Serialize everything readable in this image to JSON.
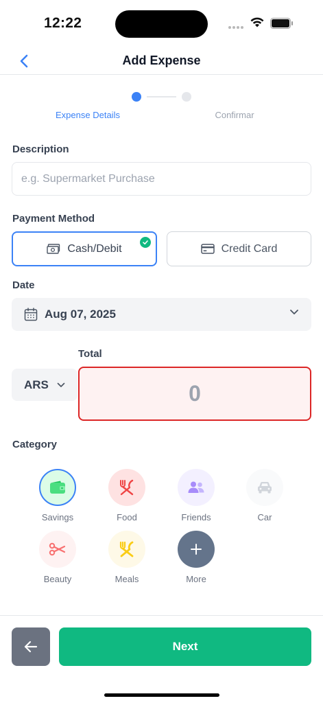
{
  "status_bar": {
    "time": "12:22"
  },
  "nav": {
    "title": "Add Expense"
  },
  "stepper": {
    "steps": [
      "Expense Details",
      "Confirmar"
    ],
    "active_step": 1
  },
  "description": {
    "label": "Description",
    "placeholder": "e.g. Supermarket Purchase",
    "value": ""
  },
  "payment": {
    "label": "Payment Method",
    "options": [
      {
        "label": "Cash/Debit",
        "icon": "cash-icon",
        "selected": true
      },
      {
        "label": "Credit Card",
        "icon": "credit-card-icon",
        "selected": false
      }
    ]
  },
  "date": {
    "label": "Date",
    "value": "Aug 07, 2025"
  },
  "total": {
    "label": "Total",
    "currency": "ARS",
    "placeholder": "0"
  },
  "category": {
    "label": "Category",
    "items": [
      {
        "label": "Savings",
        "icon": "wallet-icon",
        "color": "#4ade80",
        "bg": "#dcfce7",
        "selected": true
      },
      {
        "label": "Food",
        "icon": "utensils-icon",
        "color": "#ef4444",
        "bg": "#fee2e2",
        "selected": false
      },
      {
        "label": "Friends",
        "icon": "users-icon",
        "color": "#a78bfa",
        "bg": "#f3f0ff",
        "selected": false
      },
      {
        "label": "Car",
        "icon": "car-icon",
        "color": "#d1d5db",
        "bg": "#f9fafb",
        "selected": false
      },
      {
        "label": "Beauty",
        "icon": "scissors-icon",
        "color": "#f87171",
        "bg": "#fef2f2",
        "selected": false
      },
      {
        "label": "Meals",
        "icon": "fork-knife-icon",
        "color": "#facc15",
        "bg": "#fef9e7",
        "selected": false
      },
      {
        "label": "More",
        "icon": "plus-icon",
        "color": "#ffffff",
        "bg": "#64748b",
        "selected": false
      }
    ]
  },
  "footer": {
    "next_label": "Next"
  },
  "colors": {
    "accent": "#3b82f6",
    "success": "#10b981",
    "error": "#dc2626"
  }
}
